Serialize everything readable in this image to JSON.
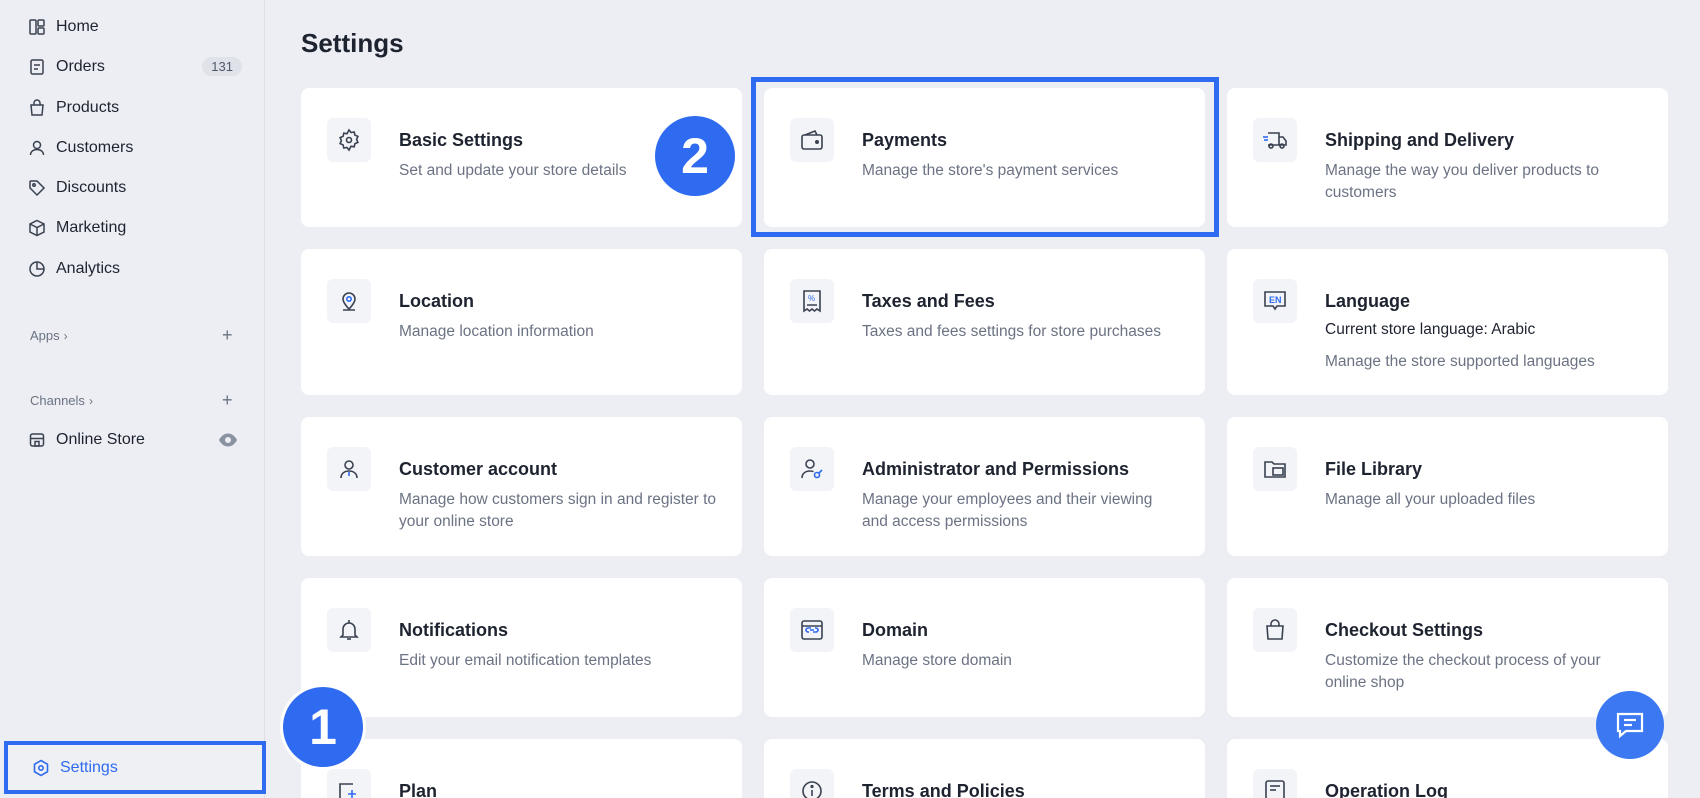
{
  "sidebar": {
    "nav": [
      {
        "label": "Home",
        "icon": "home-icon"
      },
      {
        "label": "Orders",
        "icon": "orders-icon",
        "badge": "131"
      },
      {
        "label": "Products",
        "icon": "bag-icon"
      },
      {
        "label": "Customers",
        "icon": "user-icon"
      },
      {
        "label": "Discounts",
        "icon": "tag-icon"
      },
      {
        "label": "Marketing",
        "icon": "box-icon"
      },
      {
        "label": "Analytics",
        "icon": "pie-chart-icon"
      }
    ],
    "apps_label": "Apps",
    "channels_label": "Channels",
    "online_store_label": "Online Store",
    "settings_label": "Settings",
    "add_symbol": "+",
    "chevron": "›"
  },
  "page": {
    "title": "Settings"
  },
  "cards": [
    {
      "title": "Basic Settings",
      "desc": "Set and update your store details",
      "icon": "gear-icon"
    },
    {
      "title": "Payments",
      "desc": "Manage the store's payment services",
      "icon": "wallet-icon"
    },
    {
      "title": "Shipping and Delivery",
      "desc": "Manage the way you deliver products to customers",
      "icon": "truck-icon"
    },
    {
      "title": "Location",
      "desc": "Manage location information",
      "icon": "location-pin-icon"
    },
    {
      "title": "Taxes and Fees",
      "desc": "Taxes and fees settings for store purchases",
      "icon": "receipt-icon"
    },
    {
      "title": "Language",
      "sub": "Current store language: Arabic",
      "desc": "Manage the store supported languages",
      "icon": "language-icon",
      "icon_text": "EN"
    },
    {
      "title": "Customer account",
      "desc": "Manage how customers sign in and register to your online store",
      "icon": "user-account-icon"
    },
    {
      "title": "Administrator and Permissions",
      "desc": "Manage your employees and their viewing and access permissions",
      "icon": "admin-key-icon"
    },
    {
      "title": "File Library",
      "desc": "Manage all your uploaded files",
      "icon": "folder-icon"
    },
    {
      "title": "Notifications",
      "desc": "Edit your email notification templates",
      "icon": "bell-icon"
    },
    {
      "title": "Domain",
      "desc": "Manage store domain",
      "icon": "domain-link-icon"
    },
    {
      "title": "Checkout Settings",
      "desc": "Customize the checkout process of your online shop",
      "icon": "shopping-bag-icon"
    },
    {
      "title": "Plan",
      "desc": "",
      "icon": "plan-icon"
    },
    {
      "title": "Terms and Policies",
      "desc": "",
      "icon": "info-icon"
    },
    {
      "title": "Operation Log",
      "desc": "",
      "icon": "log-icon"
    }
  ],
  "steps": [
    "1",
    "2"
  ],
  "colors": {
    "accent": "#2f6bf0",
    "background": "#eceef3",
    "card": "#ffffff"
  }
}
